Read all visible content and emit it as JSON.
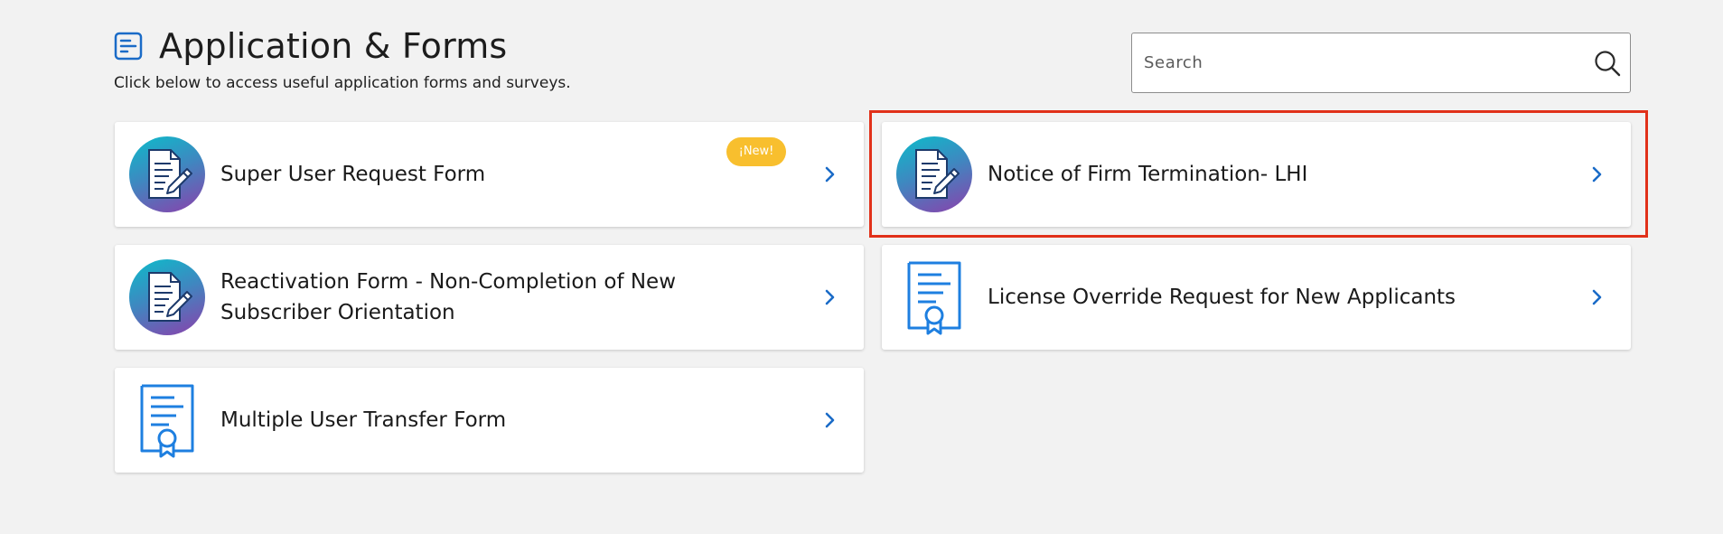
{
  "header": {
    "title": "Application & Forms",
    "subtitle": "Click below to access useful application forms and surveys.",
    "icon": "list-document-icon"
  },
  "search": {
    "placeholder": "Search",
    "value": "",
    "icon": "search-icon"
  },
  "colors": {
    "background": "#f2f2f2",
    "accent_blue": "#1a6bc7",
    "badge_yellow": "#f8bf2e",
    "highlight_red": "#e1311a",
    "gradient_teal": "#12b1c7",
    "gradient_purple": "#7a52b0",
    "certificate_blue": "#1e7fe0"
  },
  "forms": [
    {
      "label": "Super User Request Form",
      "icon": "edit-document-gradient-icon",
      "badge": "¡New!"
    },
    {
      "label": "Notice of Firm Termination- LHI",
      "icon": "edit-document-gradient-icon",
      "highlighted": true
    },
    {
      "label": "Reactivation Form - Non-Completion of New Subscriber Orientation",
      "icon": "edit-document-gradient-icon"
    },
    {
      "label": "License Override Request for New Applicants",
      "icon": "certificate-icon"
    },
    {
      "label": "Multiple User Transfer Form",
      "icon": "certificate-icon"
    }
  ]
}
